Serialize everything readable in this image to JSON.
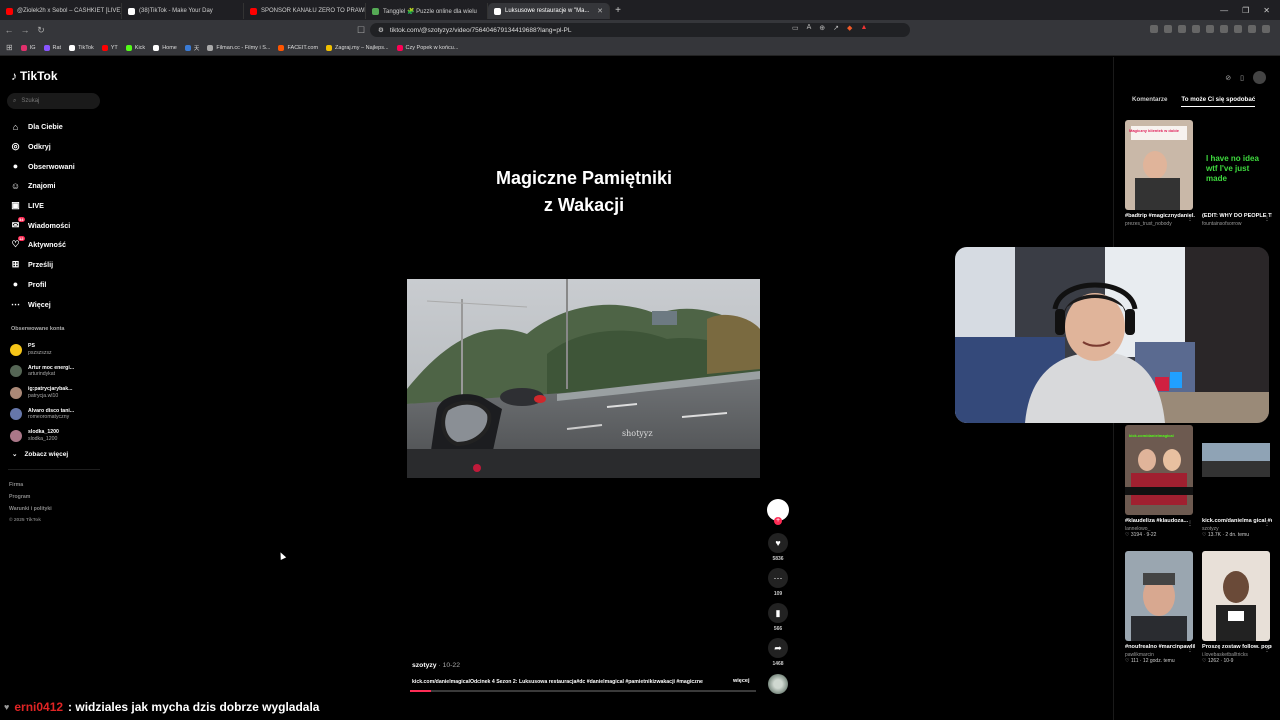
{
  "browser": {
    "tabs": [
      {
        "label": "@Ziolek2h x Sebol – CASHKIET [LIVE]",
        "color": "#ff0000",
        "active": false
      },
      {
        "label": "(38)TikTok - Make Your Day",
        "color": "#ffffff",
        "active": false
      },
      {
        "label": "SPONSOR KANAŁU ZERO TO PRAWIE",
        "color": "#ff0000",
        "active": false
      },
      {
        "label": "Tangglel 🧩 Puzzle online dla wielu",
        "color": "#55aa55",
        "active": false
      },
      {
        "label": "Luksusowe restauracje w \"Ma...",
        "color": "#ffffff",
        "active": true
      }
    ],
    "url": "tiktok.com/@szotyzyz/video/756404679134419688?lang=pl-PL",
    "bookmarks": [
      {
        "label": "IG",
        "color": "#e1306c"
      },
      {
        "label": "Rat",
        "color": "#8855ff"
      },
      {
        "label": "TikTok",
        "color": "#ffffff"
      },
      {
        "label": "YT",
        "color": "#ff0000"
      },
      {
        "label": "Kick",
        "color": "#53fc18"
      },
      {
        "label": "Home",
        "color": "#ffffff"
      },
      {
        "label": "天",
        "color": "#3a7bd5"
      },
      {
        "label": "Filman.cc - Filmy i S...",
        "color": "#aaaaaa"
      },
      {
        "label": "FACEIT.com",
        "color": "#ff5500"
      },
      {
        "label": "Zagraj.my – Najleps...",
        "color": "#f0c000"
      },
      {
        "label": "Czy Popek w końcu...",
        "color": "#ff0055"
      }
    ]
  },
  "sidebar": {
    "brand": "TikTok",
    "search_placeholder": "Szukaj",
    "nav": [
      {
        "label": "Dla Ciebie",
        "icon": "home-icon",
        "glyph": "⌂"
      },
      {
        "label": "Odkryj",
        "icon": "compass-icon",
        "glyph": "◎"
      },
      {
        "label": "Obserwowani",
        "icon": "following-avatar-icon",
        "glyph": "●"
      },
      {
        "label": "Znajomi",
        "icon": "friends-icon",
        "glyph": "☺"
      },
      {
        "label": "LIVE",
        "icon": "live-icon",
        "glyph": "▣"
      },
      {
        "label": "Wiadomości",
        "icon": "messages-icon",
        "glyph": "✉",
        "badge": "34"
      },
      {
        "label": "Aktywność",
        "icon": "activity-icon",
        "glyph": "♡",
        "badge": "12"
      },
      {
        "label": "Prześlij",
        "icon": "upload-icon",
        "glyph": "⊞"
      },
      {
        "label": "Profil",
        "icon": "profile-icon",
        "glyph": "●"
      },
      {
        "label": "Więcej",
        "icon": "more-icon",
        "glyph": "⋯"
      }
    ],
    "followed_title": "Obserwowane konta",
    "followed": [
      {
        "name": "PS",
        "handle": "pszszszsz",
        "color": "#f5c518"
      },
      {
        "name": "Artur moc energi...",
        "handle": "arturindykat",
        "color": "#556655"
      },
      {
        "name": "ig:patrycjarybak...",
        "handle": "patrycja.wl10",
        "color": "#aa8877"
      },
      {
        "name": "Alvaro disco tani...",
        "handle": "romeoromatyczny",
        "color": "#6677aa"
      },
      {
        "name": "slodka_1200",
        "handle": "slodka_1200",
        "color": "#aa7788"
      }
    ],
    "see_more": "Zobacz więcej",
    "footer": [
      "Firma",
      "Program",
      "Warunki i polityki"
    ],
    "copyright": "© 2025 TikTok"
  },
  "video": {
    "title_line1": "Magiczne Pamiętniki",
    "title_line2": "z Wakacji",
    "watermark": "shotyyz",
    "author": "szotyzy",
    "date": " · 10-22",
    "caption": "kick.com/danielmagicalOdcinek 4 Sezon 2: Luksusowa restauracja#dc #danielmagical #pamietnikizwakacji #magiczne",
    "more": "więcej",
    "progress_percent": 6,
    "likes": "5836",
    "comments": "109",
    "saves": "566",
    "shares": "1468"
  },
  "right_panel": {
    "tab_comments": "Komentarze",
    "tab_suggested": "To może Ci się spodobać",
    "cards": [
      {
        "title": "#badtrip #magicznydaniel...",
        "user": "prezes_trust_nobody",
        "meta": "",
        "thumb_text": "Magiczny klientek w dobie"
      },
      {
        "title": "(EDIT: WHY DO PEOPLE THINK I...",
        "user": "fountainsofsorrow",
        "meta": "",
        "thumb_text": "I have no idea wtf I've just made"
      },
      {
        "title": "#klaudeliza #klaudoza...",
        "user": "lannelowo_",
        "meta": "♡ 3194 · 9-22",
        "thumb_text": "kick.com/danielmagical"
      },
      {
        "title": "kick.com/danielma gical #dc #skoli...",
        "user": "szotyzy",
        "meta": "♡ 13.7K · 2 dn. temu",
        "thumb_text": ""
      },
      {
        "title": "#noufrealno #marcinpawlik...",
        "user": "pawlikmarcin",
        "meta": "♡ 111 · 12 godz. temu",
        "thumb_text": ""
      },
      {
        "title": "Proszę zostaw follow. poprzedn...",
        "user": "i.lovebasketballtricks",
        "meta": "♡ 1262 · 10-9",
        "thumb_text": ""
      }
    ]
  },
  "chat": {
    "user": "erni0412",
    "message": ": widziales jak mycha dzis dobrze wygladala"
  }
}
